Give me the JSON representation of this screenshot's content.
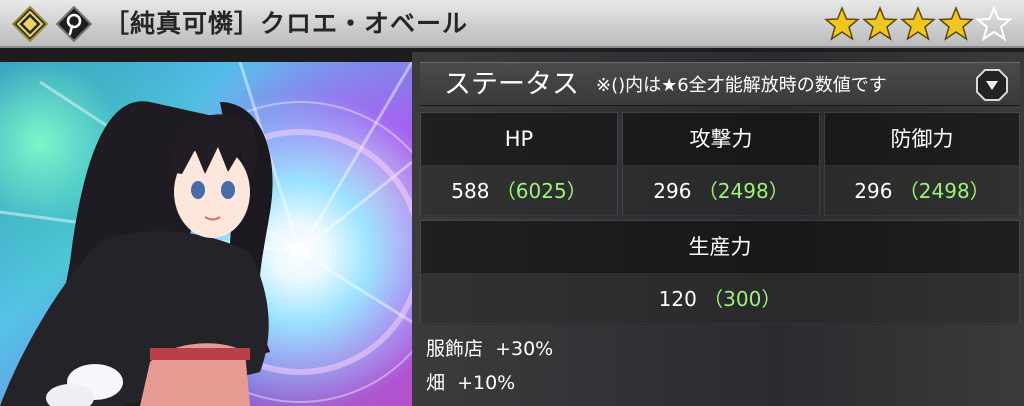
{
  "header": {
    "title": "［純真可憐］クロエ・オベール",
    "rarity": 4,
    "rarity_max": 5,
    "colors": {
      "star_filled": "#f2c521",
      "star_empty": "#ffffff"
    },
    "icons": [
      "element-badge-icon",
      "type-badge-icon"
    ]
  },
  "status": {
    "title": "ステータス",
    "note": "※()内は★6全才能解放時の数値です",
    "toggle_icon": "chevron-down-icon",
    "stats": [
      {
        "label": "HP",
        "value": "588",
        "max": "（6025）"
      },
      {
        "label": "攻撃力",
        "value": "296",
        "max": "（2498）"
      },
      {
        "label": "防御力",
        "value": "296",
        "max": "（2498）"
      },
      {
        "label": "生産力",
        "value": "120",
        "max": "（300）"
      }
    ],
    "bonuses": [
      {
        "label": "服飾店",
        "value": "+30%"
      },
      {
        "label": "畑",
        "value": "+10%"
      }
    ]
  }
}
